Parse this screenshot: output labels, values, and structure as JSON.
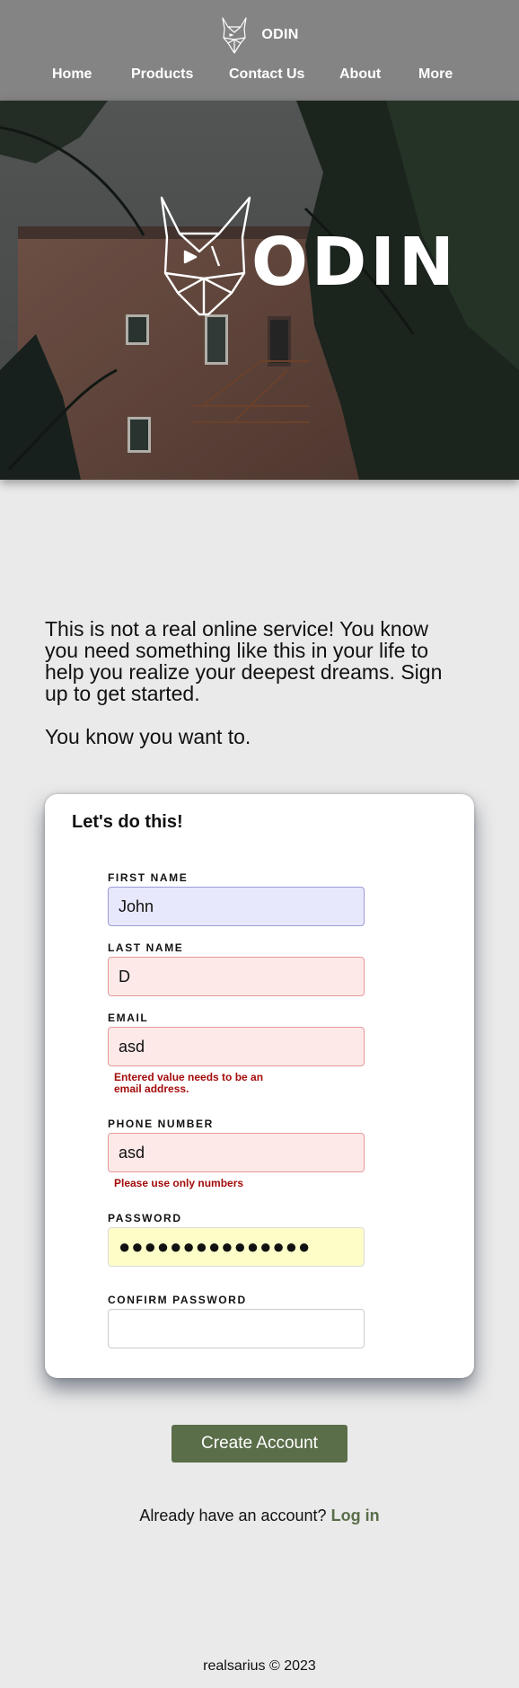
{
  "header": {
    "brand": "ODIN",
    "nav": [
      "Home",
      "Products",
      "Contact Us",
      "About",
      "More"
    ]
  },
  "hero": {
    "logo_text": "ODIN"
  },
  "intro": {
    "paragraph1": "This is not a real online service! You know you need something like this in your life to help you realize your deepest dreams. Sign up to get started.",
    "paragraph2": "You know you want to."
  },
  "form": {
    "title": "Let's do this!",
    "fields": {
      "first_name": {
        "label": "FIRST NAME",
        "value": "John",
        "state": "valid"
      },
      "last_name": {
        "label": "LAST NAME",
        "value": "D",
        "state": "invalid"
      },
      "email": {
        "label": "EMAIL",
        "value": "asd",
        "state": "invalid",
        "error": "Entered value needs to be an email address."
      },
      "phone": {
        "label": "PHONE NUMBER",
        "value": "asd",
        "state": "invalid",
        "error": "Please use only numbers"
      },
      "password": {
        "label": "PASSWORD",
        "value": "●●●●●●●●●●●●●●●",
        "state": "autofilled"
      },
      "confirm_password": {
        "label": "CONFIRM PASSWORD",
        "value": "",
        "state": "empty"
      }
    }
  },
  "actions": {
    "create_account": "Create Account",
    "login_prompt": "Already have an account?",
    "login_link": "Log in"
  },
  "footer": {
    "text": "realsarius © 2023"
  },
  "colors": {
    "header_bg": "#848484",
    "page_bg": "#eaeaea",
    "accent_green": "#5a6e49",
    "error_red": "#a30b0b",
    "valid_bg": "#e8e8fd",
    "invalid_bg": "#fee9e9",
    "autofill_bg": "#fdfdc8"
  },
  "icons": {
    "brand": "viking-helmet-logo-icon"
  }
}
